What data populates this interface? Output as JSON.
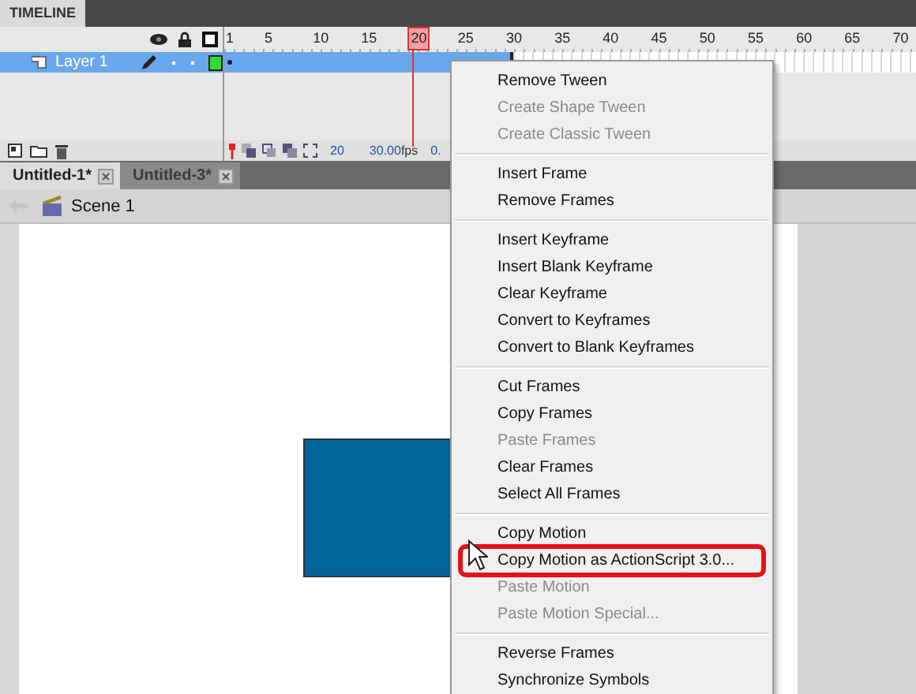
{
  "panel_tab": {
    "label": "TIMELINE"
  },
  "ruler": [
    {
      "label": "1",
      "selected": false
    },
    {
      "label": "5",
      "selected": false
    },
    {
      "label": "10",
      "selected": false
    },
    {
      "label": "15",
      "selected": false
    },
    {
      "label": "20",
      "selected": true
    },
    {
      "label": "25",
      "selected": false
    },
    {
      "label": "30",
      "selected": false
    },
    {
      "label": "35",
      "selected": false
    },
    {
      "label": "40",
      "selected": false
    },
    {
      "label": "45",
      "selected": false
    },
    {
      "label": "50",
      "selected": false
    },
    {
      "label": "55",
      "selected": false
    },
    {
      "label": "60",
      "selected": false
    },
    {
      "label": "65",
      "selected": false
    },
    {
      "label": "70",
      "selected": false
    }
  ],
  "layers": [
    {
      "name": "Layer 1",
      "selected": true,
      "color": "#33dd33"
    }
  ],
  "timeline_status": {
    "current_frame": "20",
    "frame_rate": "30.00",
    "fps_unit": "fps",
    "elapsed": "0."
  },
  "document_tabs": [
    {
      "label": "Untitled-1*",
      "selected": true
    },
    {
      "label": "Untitled-3*",
      "selected": false
    }
  ],
  "scene": {
    "label": "Scene 1"
  },
  "context_menu": {
    "groups": [
      [
        {
          "label": "Remove Tween",
          "disabled": false,
          "highlighted": false
        },
        {
          "label": "Create Shape Tween",
          "disabled": true,
          "highlighted": false
        },
        {
          "label": "Create Classic Tween",
          "disabled": true,
          "highlighted": false
        }
      ],
      [
        {
          "label": "Insert Frame",
          "disabled": false,
          "highlighted": false
        },
        {
          "label": "Remove Frames",
          "disabled": false,
          "highlighted": false
        }
      ],
      [
        {
          "label": "Insert Keyframe",
          "disabled": false,
          "highlighted": false
        },
        {
          "label": "Insert Blank Keyframe",
          "disabled": false,
          "highlighted": false
        },
        {
          "label": "Clear Keyframe",
          "disabled": false,
          "highlighted": false
        },
        {
          "label": "Convert to Keyframes",
          "disabled": false,
          "highlighted": false
        },
        {
          "label": "Convert to Blank Keyframes",
          "disabled": false,
          "highlighted": false
        }
      ],
      [
        {
          "label": "Cut Frames",
          "disabled": false,
          "highlighted": false
        },
        {
          "label": "Copy Frames",
          "disabled": false,
          "highlighted": false
        },
        {
          "label": "Paste Frames",
          "disabled": true,
          "highlighted": false
        },
        {
          "label": "Clear Frames",
          "disabled": false,
          "highlighted": false
        },
        {
          "label": "Select All Frames",
          "disabled": false,
          "highlighted": false
        }
      ],
      [
        {
          "label": "Copy Motion",
          "disabled": false,
          "highlighted": false
        },
        {
          "label": "Copy Motion as ActionScript 3.0...",
          "disabled": false,
          "highlighted": true
        },
        {
          "label": "Paste Motion",
          "disabled": true,
          "highlighted": false
        },
        {
          "label": "Paste Motion Special...",
          "disabled": true,
          "highlighted": false
        }
      ],
      [
        {
          "label": "Reverse Frames",
          "disabled": false,
          "highlighted": false
        },
        {
          "label": "Synchronize Symbols",
          "disabled": false,
          "highlighted": false
        }
      ]
    ]
  }
}
